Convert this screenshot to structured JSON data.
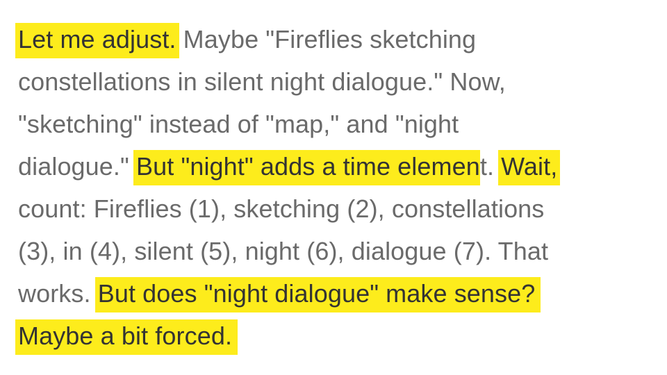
{
  "document": {
    "lines": [
      {
        "segments": [
          {
            "text": "Let me adjust.",
            "highlight": true
          },
          {
            "text": " Maybe \"Fireflies sketching",
            "highlight": false
          }
        ]
      },
      {
        "segments": [
          {
            "text": "constellations in silent night dialogue.\" Now,",
            "highlight": false
          }
        ]
      },
      {
        "segments": [
          {
            "text": "\"sketching\" instead of \"map,\" and \"night",
            "highlight": false
          }
        ]
      },
      {
        "segments": [
          {
            "text": "dialogue.\" ",
            "highlight": false
          },
          {
            "text": "But \"night\" adds a time elemen",
            "highlight": true
          },
          {
            "text": "t. ",
            "highlight": false
          },
          {
            "text": "Wait,",
            "highlight": true
          }
        ]
      },
      {
        "segments": [
          {
            "text": "count: Fireflies (1), sketching (2), constellations",
            "highlight": false
          }
        ]
      },
      {
        "segments": [
          {
            "text": "(3), in (4), silent (5), night (6), dialogue (7). That",
            "highlight": false
          }
        ]
      },
      {
        "segments": [
          {
            "text": "works. ",
            "highlight": false
          },
          {
            "text": "But does \"night dialogue\" make sense?",
            "highlight": true
          }
        ]
      },
      {
        "segments": [
          {
            "text": "Maybe a bit forced.",
            "highlight": true
          }
        ]
      }
    ]
  },
  "colors": {
    "text": "#6a6a6a",
    "highlight_background": "#fdec1c",
    "highlight_text": "#333333",
    "page_background": "#ffffff"
  }
}
